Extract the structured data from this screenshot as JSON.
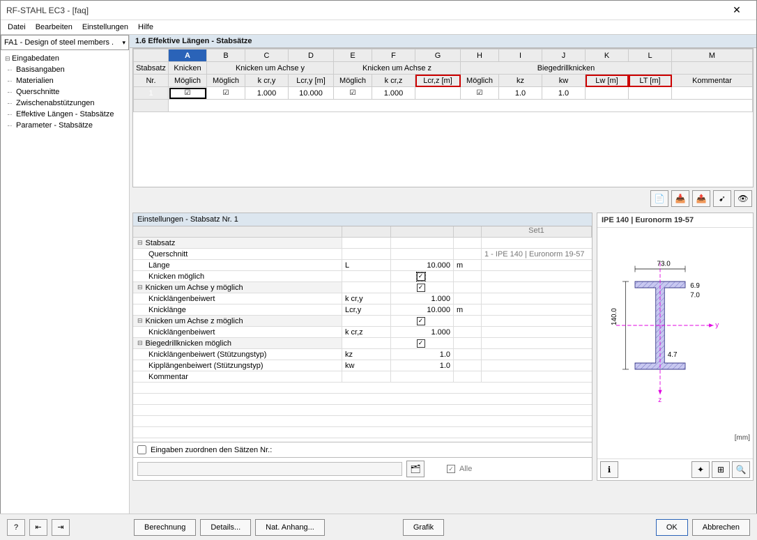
{
  "window": {
    "title": "RF-STAHL EC3 - [faq]"
  },
  "menu": {
    "file": "Datei",
    "edit": "Bearbeiten",
    "settings": "Einstellungen",
    "help": "Hilfe"
  },
  "sidebar": {
    "combo": "FA1 - Design of steel members .",
    "root": "Eingabedaten",
    "items": [
      "Basisangaben",
      "Materialien",
      "Querschnitte",
      "Zwischenabstützungen",
      "Effektive Längen - Stabsätze",
      "Parameter - Stabsätze"
    ]
  },
  "section_title": "1.6 Effektive Längen - Stabsätze",
  "grid": {
    "colLetters": [
      "A",
      "B",
      "C",
      "D",
      "E",
      "F",
      "G",
      "H",
      "I",
      "J",
      "K",
      "L",
      "M"
    ],
    "groupHeaders": {
      "stabsatz": "Stabsatz",
      "knicken": "Knicken",
      "achseY": "Knicken um Achse y",
      "achseZ": "Knicken um Achse z",
      "biege": "Biegedrillknicken"
    },
    "headers": {
      "nr": "Nr.",
      "moeglich": "Möglich",
      "kcry": "k cr,y",
      "Lcry": "Lcr,y [m]",
      "kcrz": "k cr,z",
      "Lcrz": "Lcr,z [m]",
      "kz": "kz",
      "kw": "kw",
      "Lw": "Lw [m]",
      "LT": "LT [m]",
      "kommentar": "Kommentar"
    },
    "row": {
      "nr": "1",
      "kcry": "1.000",
      "Lcry": "10.000",
      "kcrz": "1.000",
      "kz": "1.0",
      "kw": "1.0"
    }
  },
  "settings": {
    "title": "Einstellungen - Stabsatz Nr. 1",
    "set_label": "Set1",
    "rows": {
      "stabsatz": "Stabsatz",
      "querschnitt": "Querschnitt",
      "querschnitt_val": "1 - IPE 140 | Euronorm 19-57",
      "laenge": "Länge",
      "laenge_sym": "L",
      "laenge_val": "10.000",
      "laenge_unit": "m",
      "knicken": "Knicken möglich",
      "achseY": "Knicken um Achse y möglich",
      "klb": "Knicklängenbeiwert",
      "klb_y_sym": "k cr,y",
      "klb_y_val": "1.000",
      "kl": "Knicklänge",
      "kl_sym": "Lcr,y",
      "kl_val": "10.000",
      "kl_unit": "m",
      "achseZ": "Knicken um Achse z möglich",
      "klb_z_sym": "k cr,z",
      "klb_z_val": "1.000",
      "biege": "Biegedrillknicken möglich",
      "klb_stuetz": "Knicklängenbeiwert (Stützungstyp)",
      "kz_sym": "kz",
      "kz_val": "1.0",
      "kipp": "Kipplängenbeiwert (Stützungstyp)",
      "kw_sym": "kw",
      "kw_val": "1.0",
      "kommentar": "Kommentar"
    },
    "assign_label": "Eingaben zuordnen den Sätzen Nr.:",
    "alle": "Alle"
  },
  "preview": {
    "title": "IPE 140 | Euronorm 19-57",
    "dims": {
      "b": "73.0",
      "h": "140.0",
      "tf": "6.9",
      "tw": "4.7",
      "r": "7.0",
      "y": "y",
      "z": "z"
    },
    "unit": "[mm]"
  },
  "buttons": {
    "berechnung": "Berechnung",
    "details": "Details...",
    "anhang": "Nat. Anhang...",
    "grafik": "Grafik",
    "ok": "OK",
    "cancel": "Abbrechen"
  }
}
